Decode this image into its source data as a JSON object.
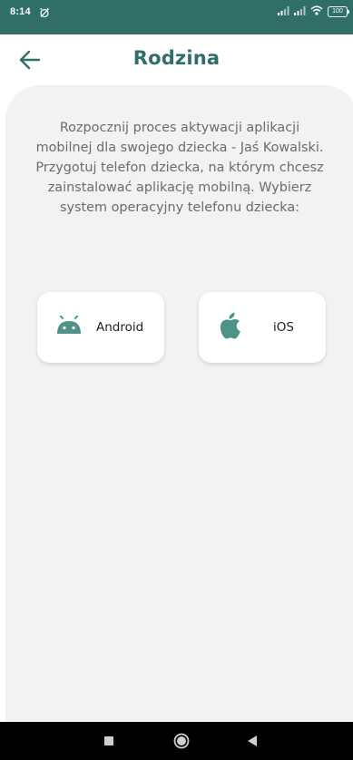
{
  "status_bar": {
    "time": "8:14",
    "battery": "100",
    "icons": [
      "alarm-icon",
      "signal-icon",
      "signal-icon",
      "wifi-icon",
      "battery-icon"
    ]
  },
  "header": {
    "title": "Rodzina",
    "back_icon": "arrow-left-icon"
  },
  "main": {
    "intro": "Rozpocznij proces aktywacji aplikacji mobilnej dla swojego dziecka - Jaś Kowalski. Przygotuj telefon dziecka, na którym chcesz zainstalować aplikację mobilną. Wybierz system operacyjny telefonu dziecka:",
    "options": [
      {
        "label": "Android",
        "icon": "android-icon"
      },
      {
        "label": "iOS",
        "icon": "apple-icon"
      }
    ]
  },
  "nav_bar": {
    "icons": [
      "recent-apps-icon",
      "home-icon",
      "back-triangle-icon"
    ]
  },
  "colors": {
    "brand": "#2f6f68",
    "accent_icon": "#4d938a",
    "panel_background": "#f4f1f2",
    "body_text": "#6b6b6b"
  }
}
